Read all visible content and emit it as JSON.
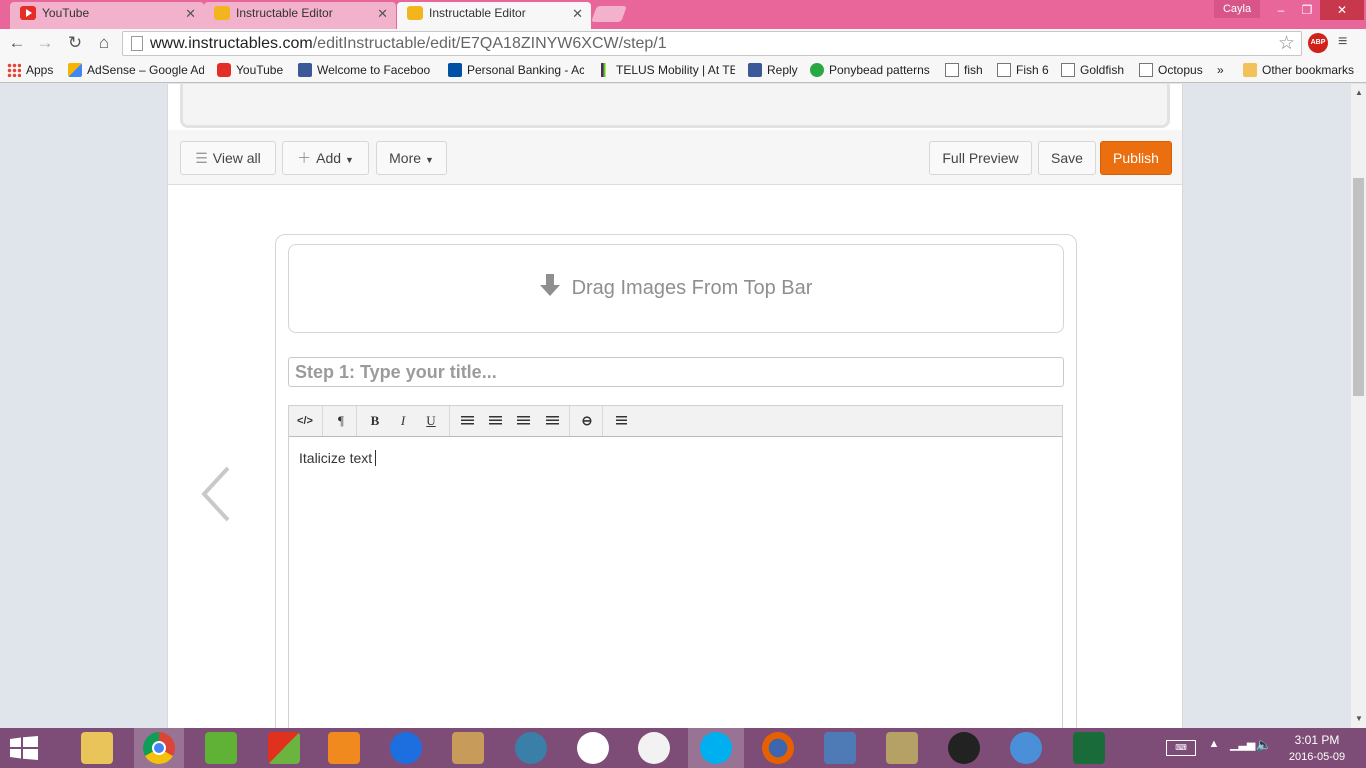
{
  "browser": {
    "tabs": [
      {
        "title": "YouTube",
        "icon": "youtube-icon",
        "active": false
      },
      {
        "title": "Instructable Editor",
        "icon": "instructables-robot-icon",
        "active": false
      },
      {
        "title": "Instructable Editor",
        "icon": "instructables-robot-icon",
        "active": true
      }
    ],
    "profile_name": "Cayla",
    "url_host": "www.instructables.com",
    "url_path": "/editInstructable/edit/E7QA18ZINYW6XCW/step/1",
    "abp_label": "ABP"
  },
  "bookmarks": {
    "items": [
      {
        "label": "Apps",
        "icon": "apps-icon"
      },
      {
        "label": "AdSense – Google Ad",
        "icon": "adsense-icon"
      },
      {
        "label": "YouTube",
        "icon": "youtube-icon"
      },
      {
        "label": "Welcome to Faceboo",
        "icon": "facebook-icon"
      },
      {
        "label": "Personal Banking - Ac",
        "icon": "rbc-icon"
      },
      {
        "label": "TELUS Mobility | At TE",
        "icon": "telus-icon"
      },
      {
        "label": "Reply",
        "icon": "facebook-icon"
      },
      {
        "label": "Ponybead patterns",
        "icon": "ponybead-icon"
      },
      {
        "label": "fish",
        "icon": "page-icon"
      },
      {
        "label": "Fish 6",
        "icon": "page-icon"
      },
      {
        "label": "Goldfish",
        "icon": "page-icon"
      },
      {
        "label": "Octopus",
        "icon": "page-icon"
      }
    ],
    "overflow": "»",
    "other": "Other bookmarks"
  },
  "editor": {
    "action_bar": {
      "view_all": "View all",
      "add": "Add",
      "more": "More",
      "full_preview": "Full Preview",
      "save": "Save",
      "publish": "Publish"
    },
    "drop_zone": "Drag Images From Top Bar",
    "title_placeholder": "Step 1:  Type your title...",
    "toolbar": {
      "html": "</>",
      "paragraph": "¶",
      "bold": "B",
      "italic": "I",
      "underline": "U"
    },
    "body_text": "Italicize text"
  },
  "taskbar": {
    "time": "3:01 PM",
    "date": "2016-05-09"
  },
  "colors": {
    "tabstrip": "#e8669a",
    "publish": "#ec6f0f",
    "taskbar": "#7d4c77"
  }
}
